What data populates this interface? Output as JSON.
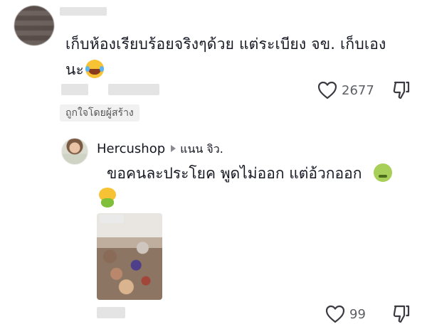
{
  "top_comment": {
    "text_line1": "เก็บห้องเรียบร้อยจริงๆด้วย แต่ระเบียง จข. เก็บเอง",
    "text_line2": "นะ",
    "emoji": "face-with-tears-of-joy",
    "liked_by_creator": "ถูกใจโดยผู้สร้าง",
    "like_count": "2677"
  },
  "reply": {
    "author": "Hercushop",
    "reply_to": "แนน จิว.",
    "text": "ขอคนละประโยค พูดไม่ออก แต่อ้วกออก",
    "emojis": [
      "nauseated-face",
      "vomiting-face"
    ],
    "like_count": "99"
  },
  "colors": {
    "text": "#161823",
    "muted": "#5f6066",
    "badge_bg": "#f1f1f2"
  }
}
